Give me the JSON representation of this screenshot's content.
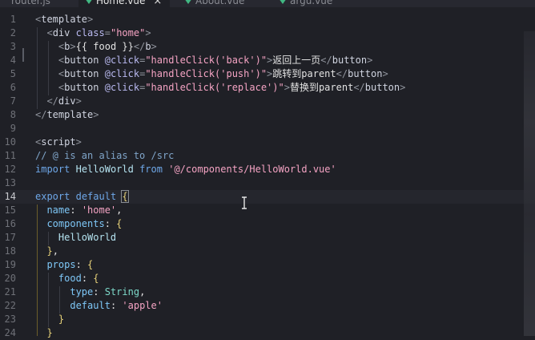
{
  "tabs": [
    {
      "label": "router.js",
      "active": false
    },
    {
      "label": "Home.vue",
      "active": true,
      "close": "×"
    },
    {
      "label": "About.vue",
      "active": false
    },
    {
      "label": "argu.vue",
      "active": false
    }
  ],
  "colors": {
    "accent_vue": "#41b883",
    "string": "#f4a3c3",
    "keyword": "#6ea7e8",
    "brace": "#e8d37a"
  },
  "editor": {
    "current_line": "14",
    "lines": [
      {
        "n": "1",
        "tokens": [
          {
            "c": "t-punct",
            "t": "<"
          },
          {
            "c": "t-tag",
            "t": "template"
          },
          {
            "c": "t-punct",
            "t": ">"
          }
        ]
      },
      {
        "n": "2",
        "tokens": [
          {
            "c": "t-plain",
            "t": "  "
          },
          {
            "c": "t-punct",
            "t": "<"
          },
          {
            "c": "t-tag",
            "t": "div"
          },
          {
            "c": "t-plain",
            "t": " "
          },
          {
            "c": "t-attr",
            "t": "class"
          },
          {
            "c": "t-punct",
            "t": "="
          },
          {
            "c": "t-str",
            "t": "\"home\""
          },
          {
            "c": "t-punct",
            "t": ">"
          }
        ]
      },
      {
        "n": "3",
        "tokens": [
          {
            "c": "t-plain",
            "t": "    "
          },
          {
            "c": "t-punct",
            "t": "<"
          },
          {
            "c": "t-tag",
            "t": "b"
          },
          {
            "c": "t-punct",
            "t": ">"
          },
          {
            "c": "t-plain",
            "t": "{{ food }}"
          },
          {
            "c": "t-punct",
            "t": "</"
          },
          {
            "c": "t-tag",
            "t": "b"
          },
          {
            "c": "t-punct",
            "t": ">"
          }
        ]
      },
      {
        "n": "4",
        "tokens": [
          {
            "c": "t-plain",
            "t": "    "
          },
          {
            "c": "t-punct",
            "t": "<"
          },
          {
            "c": "t-tag",
            "t": "button"
          },
          {
            "c": "t-plain",
            "t": " "
          },
          {
            "c": "t-attr",
            "t": "@click"
          },
          {
            "c": "t-punct",
            "t": "="
          },
          {
            "c": "t-str",
            "t": "\"handleClick('back')\""
          },
          {
            "c": "t-punct",
            "t": ">"
          },
          {
            "c": "t-plain",
            "t": "返回上一页"
          },
          {
            "c": "t-punct",
            "t": "</"
          },
          {
            "c": "t-tag",
            "t": "button"
          },
          {
            "c": "t-punct",
            "t": ">"
          }
        ]
      },
      {
        "n": "5",
        "tokens": [
          {
            "c": "t-plain",
            "t": "    "
          },
          {
            "c": "t-punct",
            "t": "<"
          },
          {
            "c": "t-tag",
            "t": "button"
          },
          {
            "c": "t-plain",
            "t": " "
          },
          {
            "c": "t-attr",
            "t": "@click"
          },
          {
            "c": "t-punct",
            "t": "="
          },
          {
            "c": "t-str",
            "t": "\"handleClick('push')\""
          },
          {
            "c": "t-punct",
            "t": ">"
          },
          {
            "c": "t-plain",
            "t": "跳转到parent"
          },
          {
            "c": "t-punct",
            "t": "</"
          },
          {
            "c": "t-tag",
            "t": "button"
          },
          {
            "c": "t-punct",
            "t": ">"
          }
        ]
      },
      {
        "n": "6",
        "tokens": [
          {
            "c": "t-plain",
            "t": "    "
          },
          {
            "c": "t-punct",
            "t": "<"
          },
          {
            "c": "t-tag",
            "t": "button"
          },
          {
            "c": "t-plain",
            "t": " "
          },
          {
            "c": "t-attr",
            "t": "@click"
          },
          {
            "c": "t-punct",
            "t": "="
          },
          {
            "c": "t-str",
            "t": "\"handleClick('replace')\""
          },
          {
            "c": "t-punct",
            "t": ">"
          },
          {
            "c": "t-plain",
            "t": "替换到parent"
          },
          {
            "c": "t-punct",
            "t": "</"
          },
          {
            "c": "t-tag",
            "t": "button"
          },
          {
            "c": "t-punct",
            "t": ">"
          }
        ]
      },
      {
        "n": "7",
        "tokens": [
          {
            "c": "t-plain",
            "t": "  "
          },
          {
            "c": "t-punct",
            "t": "</"
          },
          {
            "c": "t-tag",
            "t": "div"
          },
          {
            "c": "t-punct",
            "t": ">"
          }
        ]
      },
      {
        "n": "8",
        "tokens": [
          {
            "c": "t-punct",
            "t": "</"
          },
          {
            "c": "t-tag",
            "t": "template"
          },
          {
            "c": "t-punct",
            "t": ">"
          }
        ]
      },
      {
        "n": "9",
        "tokens": []
      },
      {
        "n": "10",
        "tokens": [
          {
            "c": "t-punct",
            "t": "<"
          },
          {
            "c": "t-tag",
            "t": "script"
          },
          {
            "c": "t-punct",
            "t": ">"
          }
        ]
      },
      {
        "n": "11",
        "tokens": [
          {
            "c": "t-comment",
            "t": "// @ is an alias to /src"
          }
        ]
      },
      {
        "n": "12",
        "tokens": [
          {
            "c": "t-kw",
            "t": "import"
          },
          {
            "c": "t-plain",
            "t": " "
          },
          {
            "c": "t-ident",
            "t": "HelloWorld"
          },
          {
            "c": "t-plain",
            "t": " "
          },
          {
            "c": "t-kw",
            "t": "from"
          },
          {
            "c": "t-plain",
            "t": " "
          },
          {
            "c": "t-str",
            "t": "'@/components/HelloWorld.vue'"
          }
        ]
      },
      {
        "n": "13",
        "tokens": []
      },
      {
        "n": "14",
        "tokens": [
          {
            "c": "t-kw",
            "t": "export"
          },
          {
            "c": "t-plain",
            "t": " "
          },
          {
            "c": "t-kw",
            "t": "default"
          },
          {
            "c": "t-plain",
            "t": " "
          },
          {
            "c": "t-bracehl",
            "t": "{"
          }
        ]
      },
      {
        "n": "15",
        "tokens": [
          {
            "c": "t-plain",
            "t": "  "
          },
          {
            "c": "t-key",
            "t": "name"
          },
          {
            "c": "t-plain",
            "t": ": "
          },
          {
            "c": "t-str",
            "t": "'home'"
          },
          {
            "c": "t-plain",
            "t": ","
          }
        ]
      },
      {
        "n": "16",
        "tokens": [
          {
            "c": "t-plain",
            "t": "  "
          },
          {
            "c": "t-key",
            "t": "components"
          },
          {
            "c": "t-plain",
            "t": ": "
          },
          {
            "c": "t-brace",
            "t": "{"
          }
        ]
      },
      {
        "n": "17",
        "tokens": [
          {
            "c": "t-plain",
            "t": "    "
          },
          {
            "c": "t-ident",
            "t": "HelloWorld"
          }
        ]
      },
      {
        "n": "18",
        "tokens": [
          {
            "c": "t-plain",
            "t": "  "
          },
          {
            "c": "t-brace",
            "t": "}"
          },
          {
            "c": "t-plain",
            "t": ","
          }
        ]
      },
      {
        "n": "19",
        "tokens": [
          {
            "c": "t-plain",
            "t": "  "
          },
          {
            "c": "t-key",
            "t": "props"
          },
          {
            "c": "t-plain",
            "t": ": "
          },
          {
            "c": "t-brace",
            "t": "{"
          }
        ]
      },
      {
        "n": "20",
        "tokens": [
          {
            "c": "t-plain",
            "t": "    "
          },
          {
            "c": "t-key",
            "t": "food"
          },
          {
            "c": "t-plain",
            "t": ": "
          },
          {
            "c": "t-brace",
            "t": "{"
          }
        ]
      },
      {
        "n": "21",
        "tokens": [
          {
            "c": "t-plain",
            "t": "      "
          },
          {
            "c": "t-key",
            "t": "type"
          },
          {
            "c": "t-plain",
            "t": ": "
          },
          {
            "c": "t-type",
            "t": "String"
          },
          {
            "c": "t-plain",
            "t": ","
          }
        ]
      },
      {
        "n": "22",
        "tokens": [
          {
            "c": "t-plain",
            "t": "      "
          },
          {
            "c": "t-key",
            "t": "default"
          },
          {
            "c": "t-plain",
            "t": ": "
          },
          {
            "c": "t-str",
            "t": "'apple'"
          }
        ]
      },
      {
        "n": "23",
        "tokens": [
          {
            "c": "t-plain",
            "t": "    "
          },
          {
            "c": "t-brace",
            "t": "}"
          }
        ]
      },
      {
        "n": "24",
        "tokens": [
          {
            "c": "t-plain",
            "t": "  "
          },
          {
            "c": "t-brace",
            "t": "}"
          }
        ]
      }
    ]
  }
}
